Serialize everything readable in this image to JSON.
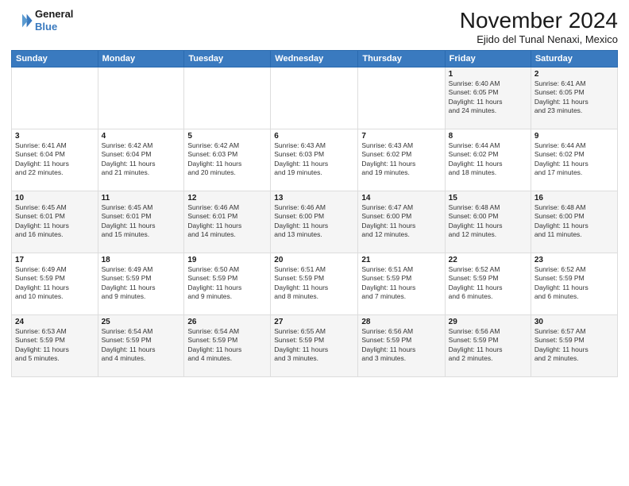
{
  "header": {
    "logo_line1": "General",
    "logo_line2": "Blue",
    "month_title": "November 2024",
    "location": "Ejido del Tunal Nenaxi, Mexico"
  },
  "weekdays": [
    "Sunday",
    "Monday",
    "Tuesday",
    "Wednesday",
    "Thursday",
    "Friday",
    "Saturday"
  ],
  "weeks": [
    [
      {
        "day": "",
        "info": ""
      },
      {
        "day": "",
        "info": ""
      },
      {
        "day": "",
        "info": ""
      },
      {
        "day": "",
        "info": ""
      },
      {
        "day": "",
        "info": ""
      },
      {
        "day": "1",
        "info": "Sunrise: 6:40 AM\nSunset: 6:05 PM\nDaylight: 11 hours\nand 24 minutes."
      },
      {
        "day": "2",
        "info": "Sunrise: 6:41 AM\nSunset: 6:05 PM\nDaylight: 11 hours\nand 23 minutes."
      }
    ],
    [
      {
        "day": "3",
        "info": "Sunrise: 6:41 AM\nSunset: 6:04 PM\nDaylight: 11 hours\nand 22 minutes."
      },
      {
        "day": "4",
        "info": "Sunrise: 6:42 AM\nSunset: 6:04 PM\nDaylight: 11 hours\nand 21 minutes."
      },
      {
        "day": "5",
        "info": "Sunrise: 6:42 AM\nSunset: 6:03 PM\nDaylight: 11 hours\nand 20 minutes."
      },
      {
        "day": "6",
        "info": "Sunrise: 6:43 AM\nSunset: 6:03 PM\nDaylight: 11 hours\nand 19 minutes."
      },
      {
        "day": "7",
        "info": "Sunrise: 6:43 AM\nSunset: 6:02 PM\nDaylight: 11 hours\nand 19 minutes."
      },
      {
        "day": "8",
        "info": "Sunrise: 6:44 AM\nSunset: 6:02 PM\nDaylight: 11 hours\nand 18 minutes."
      },
      {
        "day": "9",
        "info": "Sunrise: 6:44 AM\nSunset: 6:02 PM\nDaylight: 11 hours\nand 17 minutes."
      }
    ],
    [
      {
        "day": "10",
        "info": "Sunrise: 6:45 AM\nSunset: 6:01 PM\nDaylight: 11 hours\nand 16 minutes."
      },
      {
        "day": "11",
        "info": "Sunrise: 6:45 AM\nSunset: 6:01 PM\nDaylight: 11 hours\nand 15 minutes."
      },
      {
        "day": "12",
        "info": "Sunrise: 6:46 AM\nSunset: 6:01 PM\nDaylight: 11 hours\nand 14 minutes."
      },
      {
        "day": "13",
        "info": "Sunrise: 6:46 AM\nSunset: 6:00 PM\nDaylight: 11 hours\nand 13 minutes."
      },
      {
        "day": "14",
        "info": "Sunrise: 6:47 AM\nSunset: 6:00 PM\nDaylight: 11 hours\nand 12 minutes."
      },
      {
        "day": "15",
        "info": "Sunrise: 6:48 AM\nSunset: 6:00 PM\nDaylight: 11 hours\nand 12 minutes."
      },
      {
        "day": "16",
        "info": "Sunrise: 6:48 AM\nSunset: 6:00 PM\nDaylight: 11 hours\nand 11 minutes."
      }
    ],
    [
      {
        "day": "17",
        "info": "Sunrise: 6:49 AM\nSunset: 5:59 PM\nDaylight: 11 hours\nand 10 minutes."
      },
      {
        "day": "18",
        "info": "Sunrise: 6:49 AM\nSunset: 5:59 PM\nDaylight: 11 hours\nand 9 minutes."
      },
      {
        "day": "19",
        "info": "Sunrise: 6:50 AM\nSunset: 5:59 PM\nDaylight: 11 hours\nand 9 minutes."
      },
      {
        "day": "20",
        "info": "Sunrise: 6:51 AM\nSunset: 5:59 PM\nDaylight: 11 hours\nand 8 minutes."
      },
      {
        "day": "21",
        "info": "Sunrise: 6:51 AM\nSunset: 5:59 PM\nDaylight: 11 hours\nand 7 minutes."
      },
      {
        "day": "22",
        "info": "Sunrise: 6:52 AM\nSunset: 5:59 PM\nDaylight: 11 hours\nand 6 minutes."
      },
      {
        "day": "23",
        "info": "Sunrise: 6:52 AM\nSunset: 5:59 PM\nDaylight: 11 hours\nand 6 minutes."
      }
    ],
    [
      {
        "day": "24",
        "info": "Sunrise: 6:53 AM\nSunset: 5:59 PM\nDaylight: 11 hours\nand 5 minutes."
      },
      {
        "day": "25",
        "info": "Sunrise: 6:54 AM\nSunset: 5:59 PM\nDaylight: 11 hours\nand 4 minutes."
      },
      {
        "day": "26",
        "info": "Sunrise: 6:54 AM\nSunset: 5:59 PM\nDaylight: 11 hours\nand 4 minutes."
      },
      {
        "day": "27",
        "info": "Sunrise: 6:55 AM\nSunset: 5:59 PM\nDaylight: 11 hours\nand 3 minutes."
      },
      {
        "day": "28",
        "info": "Sunrise: 6:56 AM\nSunset: 5:59 PM\nDaylight: 11 hours\nand 3 minutes."
      },
      {
        "day": "29",
        "info": "Sunrise: 6:56 AM\nSunset: 5:59 PM\nDaylight: 11 hours\nand 2 minutes."
      },
      {
        "day": "30",
        "info": "Sunrise: 6:57 AM\nSunset: 5:59 PM\nDaylight: 11 hours\nand 2 minutes."
      }
    ]
  ]
}
